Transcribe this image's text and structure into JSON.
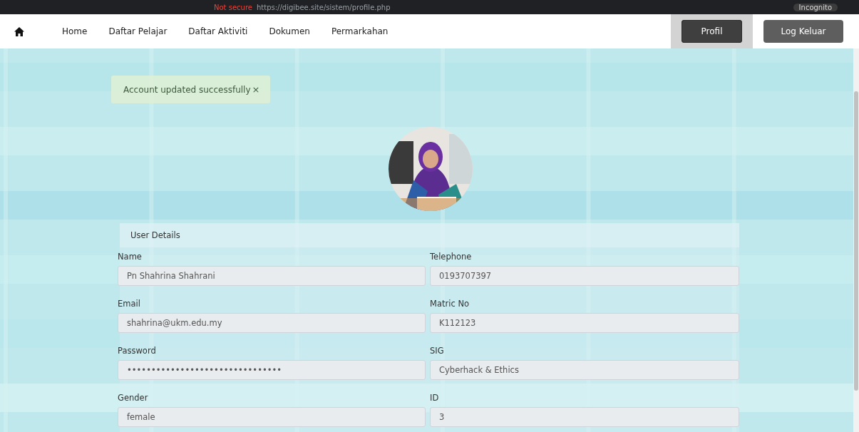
{
  "browser": {
    "security": "Not secure",
    "url": "https://digibee.site/sistem/profile.php",
    "profile": "Incognito"
  },
  "nav": {
    "items": [
      {
        "label": "Home"
      },
      {
        "label": "Daftar Pelajar"
      },
      {
        "label": "Daftar Aktiviti"
      },
      {
        "label": "Dokumen"
      },
      {
        "label": "Permarkahan"
      }
    ],
    "buttons": [
      {
        "label": "Profil",
        "selected": true
      },
      {
        "label": "Log Keluar",
        "selected": false
      }
    ]
  },
  "alert": {
    "message": "Account updated successfully",
    "close": "×"
  },
  "form": {
    "title": "User Details",
    "fields": [
      {
        "label": "Name",
        "value": "Pn Shahrina Shahrani"
      },
      {
        "label": "Telephone",
        "value": "0193707397"
      },
      {
        "label": "Email",
        "value": "shahrina@ukm.edu.my"
      },
      {
        "label": "Matric No",
        "value": "K112123"
      },
      {
        "label": "Password",
        "value": "••••••••••••••••••••••••••••••••"
      },
      {
        "label": "SIG",
        "value": "Cyberhack & Ethics"
      },
      {
        "label": "Gender",
        "value": "female"
      },
      {
        "label": "ID",
        "value": "3"
      }
    ]
  }
}
